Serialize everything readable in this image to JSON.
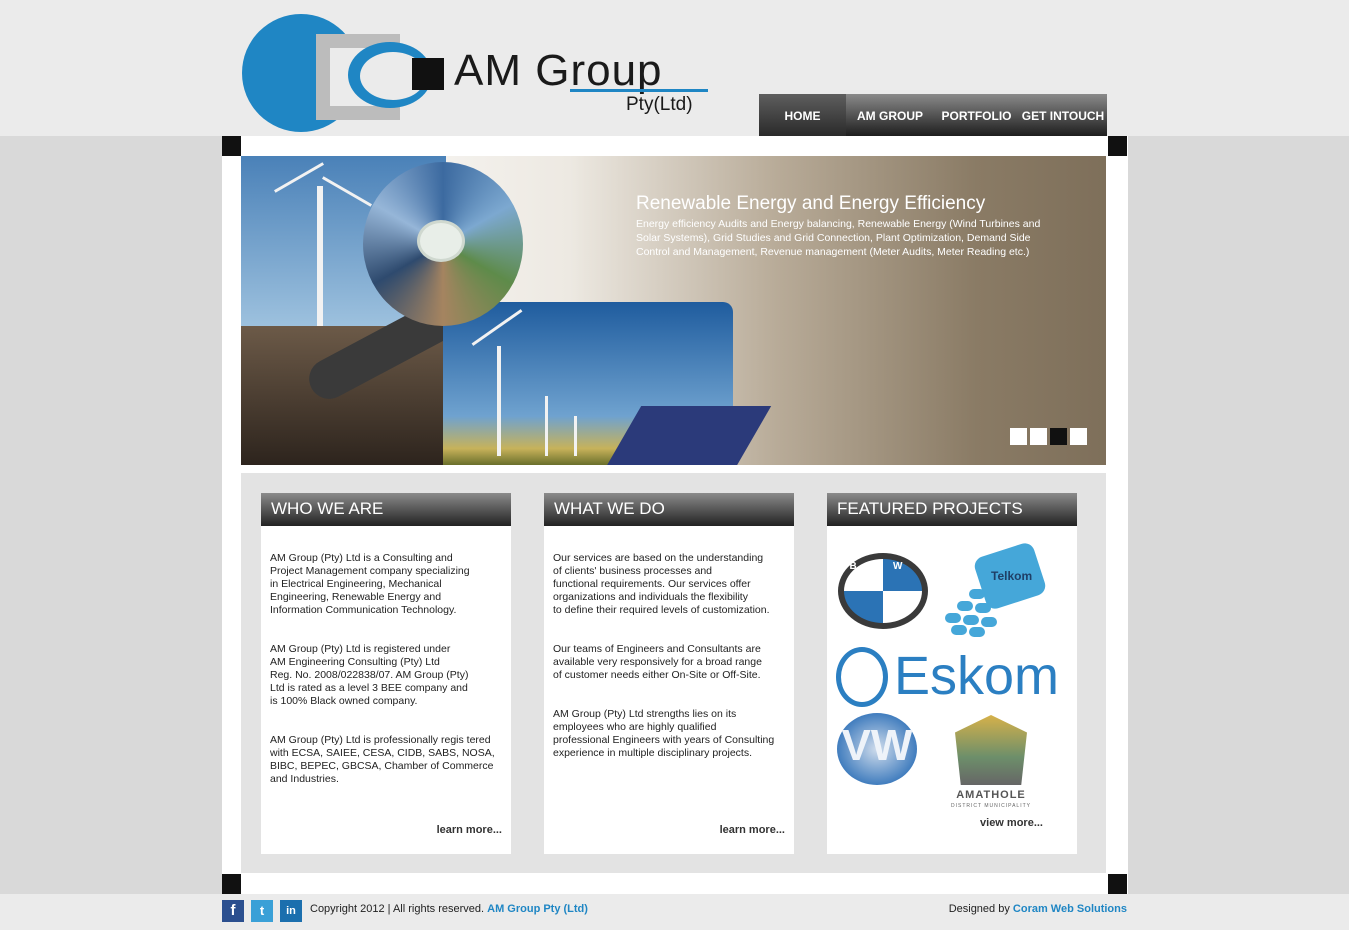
{
  "brand": {
    "name": "AM Group",
    "suffix": "Pty(Ltd)",
    "blue": "#1f86c4"
  },
  "nav": [
    "HOME",
    "AM GROUP",
    "PORTFOLIO",
    "GET INTOUCH"
  ],
  "slider": {
    "title": "Renewable Energy and Energy Efficiency",
    "description": "Energy efficiency Audits and Energy balancing, Renewable Energy (Wind Turbines and Solar Systems), Grid Studies and Grid Connection, Plant Optimization, Demand Side Control and Management, Revenue management (Meter Audits, Meter Reading etc.)",
    "active_dot": 3
  },
  "who_we_are": {
    "heading": "WHO WE ARE",
    "p1": "AM Group (Pty) Ltd is a Consulting and\nProject Management company specializing\nin Electrical Engineering, Mechanical\nEngineering, Renewable Energy and\nInformation Communication Technology.",
    "p2": "AM Group (Pty) Ltd is registered under\nAM Engineering Consulting (Pty) Ltd\nReg. No. 2008/022838/07. AM Group (Pty)\nLtd is rated as a level 3 BEE company and\nis 100% Black owned company.",
    "p3": "AM Group (Pty) Ltd is professionally regis tered\nwith ECSA, SAIEE, CESA, CIDB, SABS, NOSA,\nBIBC, BEPEC, GBCSA, Chamber of Commerce\nand Industries.",
    "more": "learn more..."
  },
  "what_we_do": {
    "heading": "WHAT WE DO",
    "p1": "Our services are based on the understanding\nof clients' business processes and\nfunctional requirements. Our services offer\norganizations and individuals the flexibility\nto define their required levels of customization.",
    "p2": "Our teams of Engineers and Consultants are\navailable very responsively for a broad range\nof customer needs either On-Site or Off-Site.",
    "p3": "AM Group (Pty) Ltd strengths lies on its\nemployees who are highly qualified\nprofessional Engineers with years of Consulting\nexperience in multiple disciplinary projects.",
    "more": "learn more..."
  },
  "featured": {
    "heading": "FEATURED PROJECTS",
    "logos": {
      "bmw": "BMW",
      "telkom": "Telkom",
      "eskom": "Eskom",
      "vw": "VW",
      "amathole": "AMATHOLE",
      "amathole_sub": "DISTRICT MUNICIPALITY"
    },
    "more": "view more..."
  },
  "footer": {
    "copyright": "Copyright 2012 | All rights reserved.",
    "company": "AM Group Pty (Ltd)",
    "designed_by": "Designed by",
    "designer": "Coram Web Solutions",
    "social": {
      "facebook": "f",
      "twitter": "t",
      "linkedin": "in"
    }
  }
}
